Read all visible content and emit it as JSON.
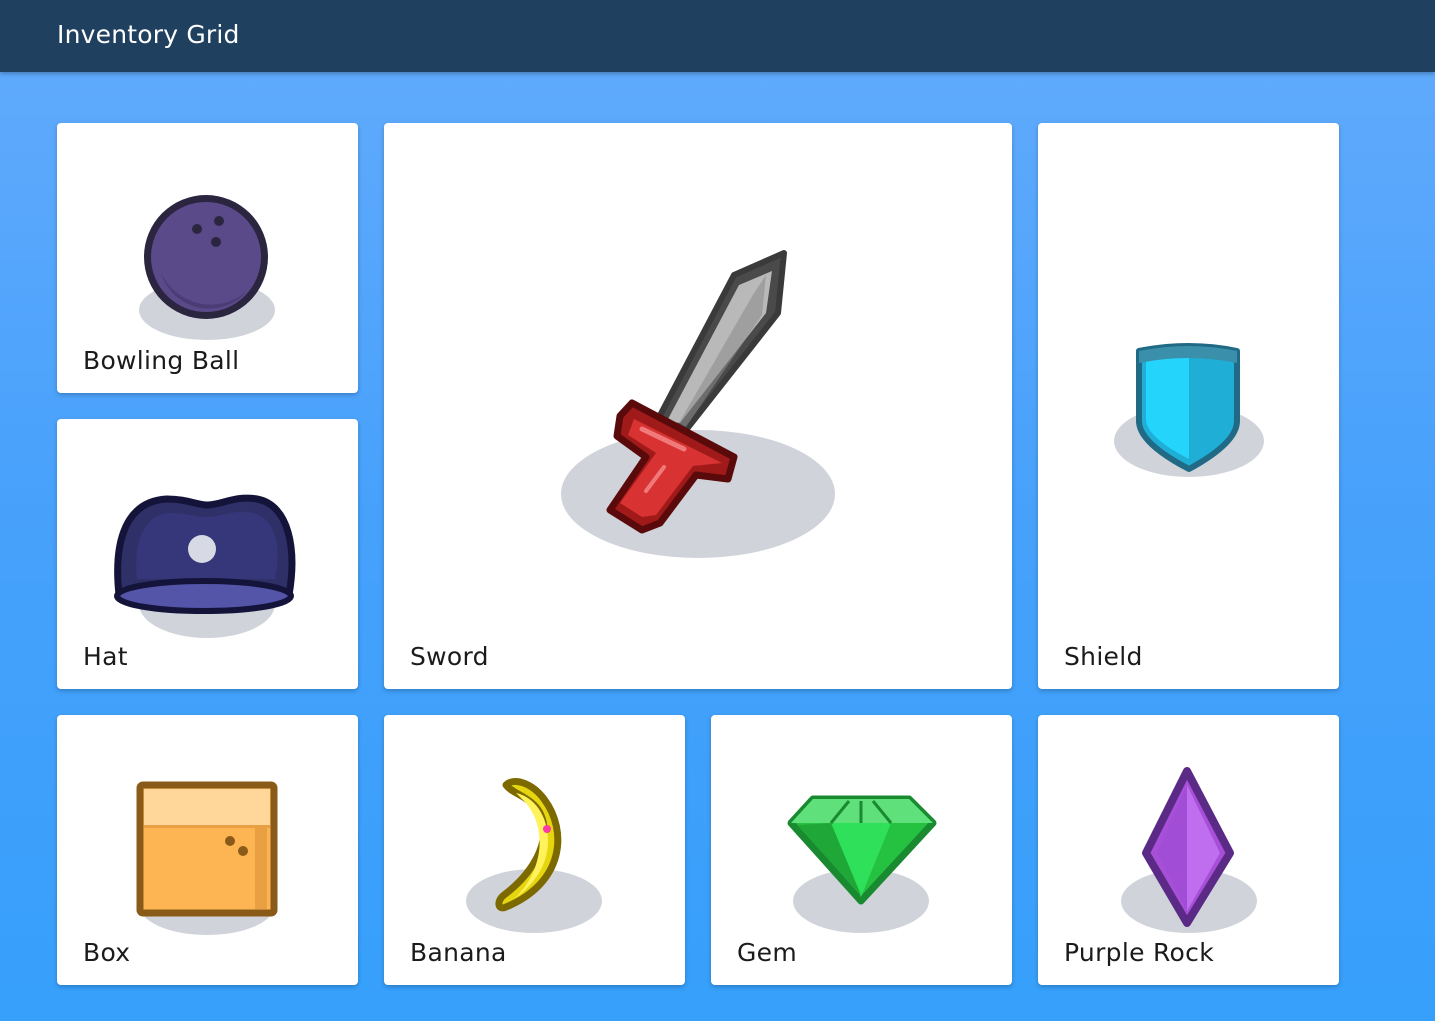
{
  "header": {
    "title": "Inventory Grid",
    "background": "#1f405f"
  },
  "items": [
    {
      "name": "Bowling Ball",
      "icon": "bowling-ball-icon"
    },
    {
      "name": "Sword",
      "icon": "sword-icon"
    },
    {
      "name": "Shield",
      "icon": "shield-icon"
    },
    {
      "name": "Hat",
      "icon": "hat-icon"
    },
    {
      "name": "Box",
      "icon": "box-icon"
    },
    {
      "name": "Banana",
      "icon": "banana-icon"
    },
    {
      "name": "Gem",
      "icon": "gem-icon"
    },
    {
      "name": "Purple Rock",
      "icon": "purple-rock-icon"
    }
  ],
  "colors": {
    "background_top": "#63abfc",
    "background_bottom": "#36a0fb",
    "card": "#ffffff",
    "shadow": "#d0d3da"
  }
}
